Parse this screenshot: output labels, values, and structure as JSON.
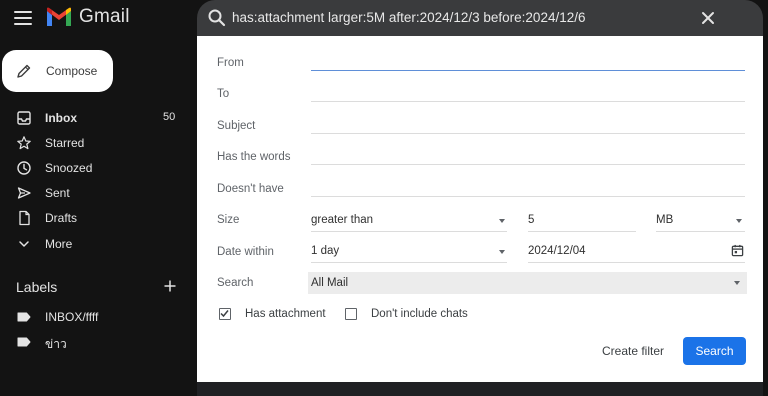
{
  "app": {
    "name": "Gmail"
  },
  "search": {
    "query": "has:attachment larger:5M after:2024/12/3 before:2024/12/6"
  },
  "compose": {
    "label": "Compose"
  },
  "nav": {
    "items": [
      {
        "label": "Inbox",
        "count": "50",
        "icon": "inbox-icon"
      },
      {
        "label": "Starred",
        "icon": "star-icon"
      },
      {
        "label": "Snoozed",
        "icon": "clock-icon"
      },
      {
        "label": "Sent",
        "icon": "send-icon"
      },
      {
        "label": "Drafts",
        "icon": "draft-icon"
      },
      {
        "label": "More",
        "icon": "chevron-down-icon"
      }
    ]
  },
  "labels": {
    "title": "Labels",
    "items": [
      {
        "label": "INBOX/ffff",
        "icon": "label-icon"
      },
      {
        "label": "ข่าว",
        "icon": "label-icon"
      }
    ]
  },
  "advanced": {
    "from_label": "From",
    "to_label": "To",
    "subject_label": "Subject",
    "has_words_label": "Has the words",
    "doesnt_have_label": "Doesn't have",
    "size_label": "Size",
    "size_operator": "greater than",
    "size_value": "5",
    "size_unit": "MB",
    "date_within_label": "Date within",
    "date_within_value": "1 day",
    "date_value": "2024/12/04",
    "search_label": "Search",
    "search_scope": "All Mail",
    "has_attachment_label": "Has attachment",
    "has_attachment_checked": true,
    "dont_include_chats_label": "Don't include chats",
    "dont_include_chats_checked": false,
    "create_filter_label": "Create filter",
    "search_button_label": "Search"
  },
  "colors": {
    "accent": "#1b73e8",
    "background": "#131313",
    "searchbar": "#3a3b3d"
  }
}
